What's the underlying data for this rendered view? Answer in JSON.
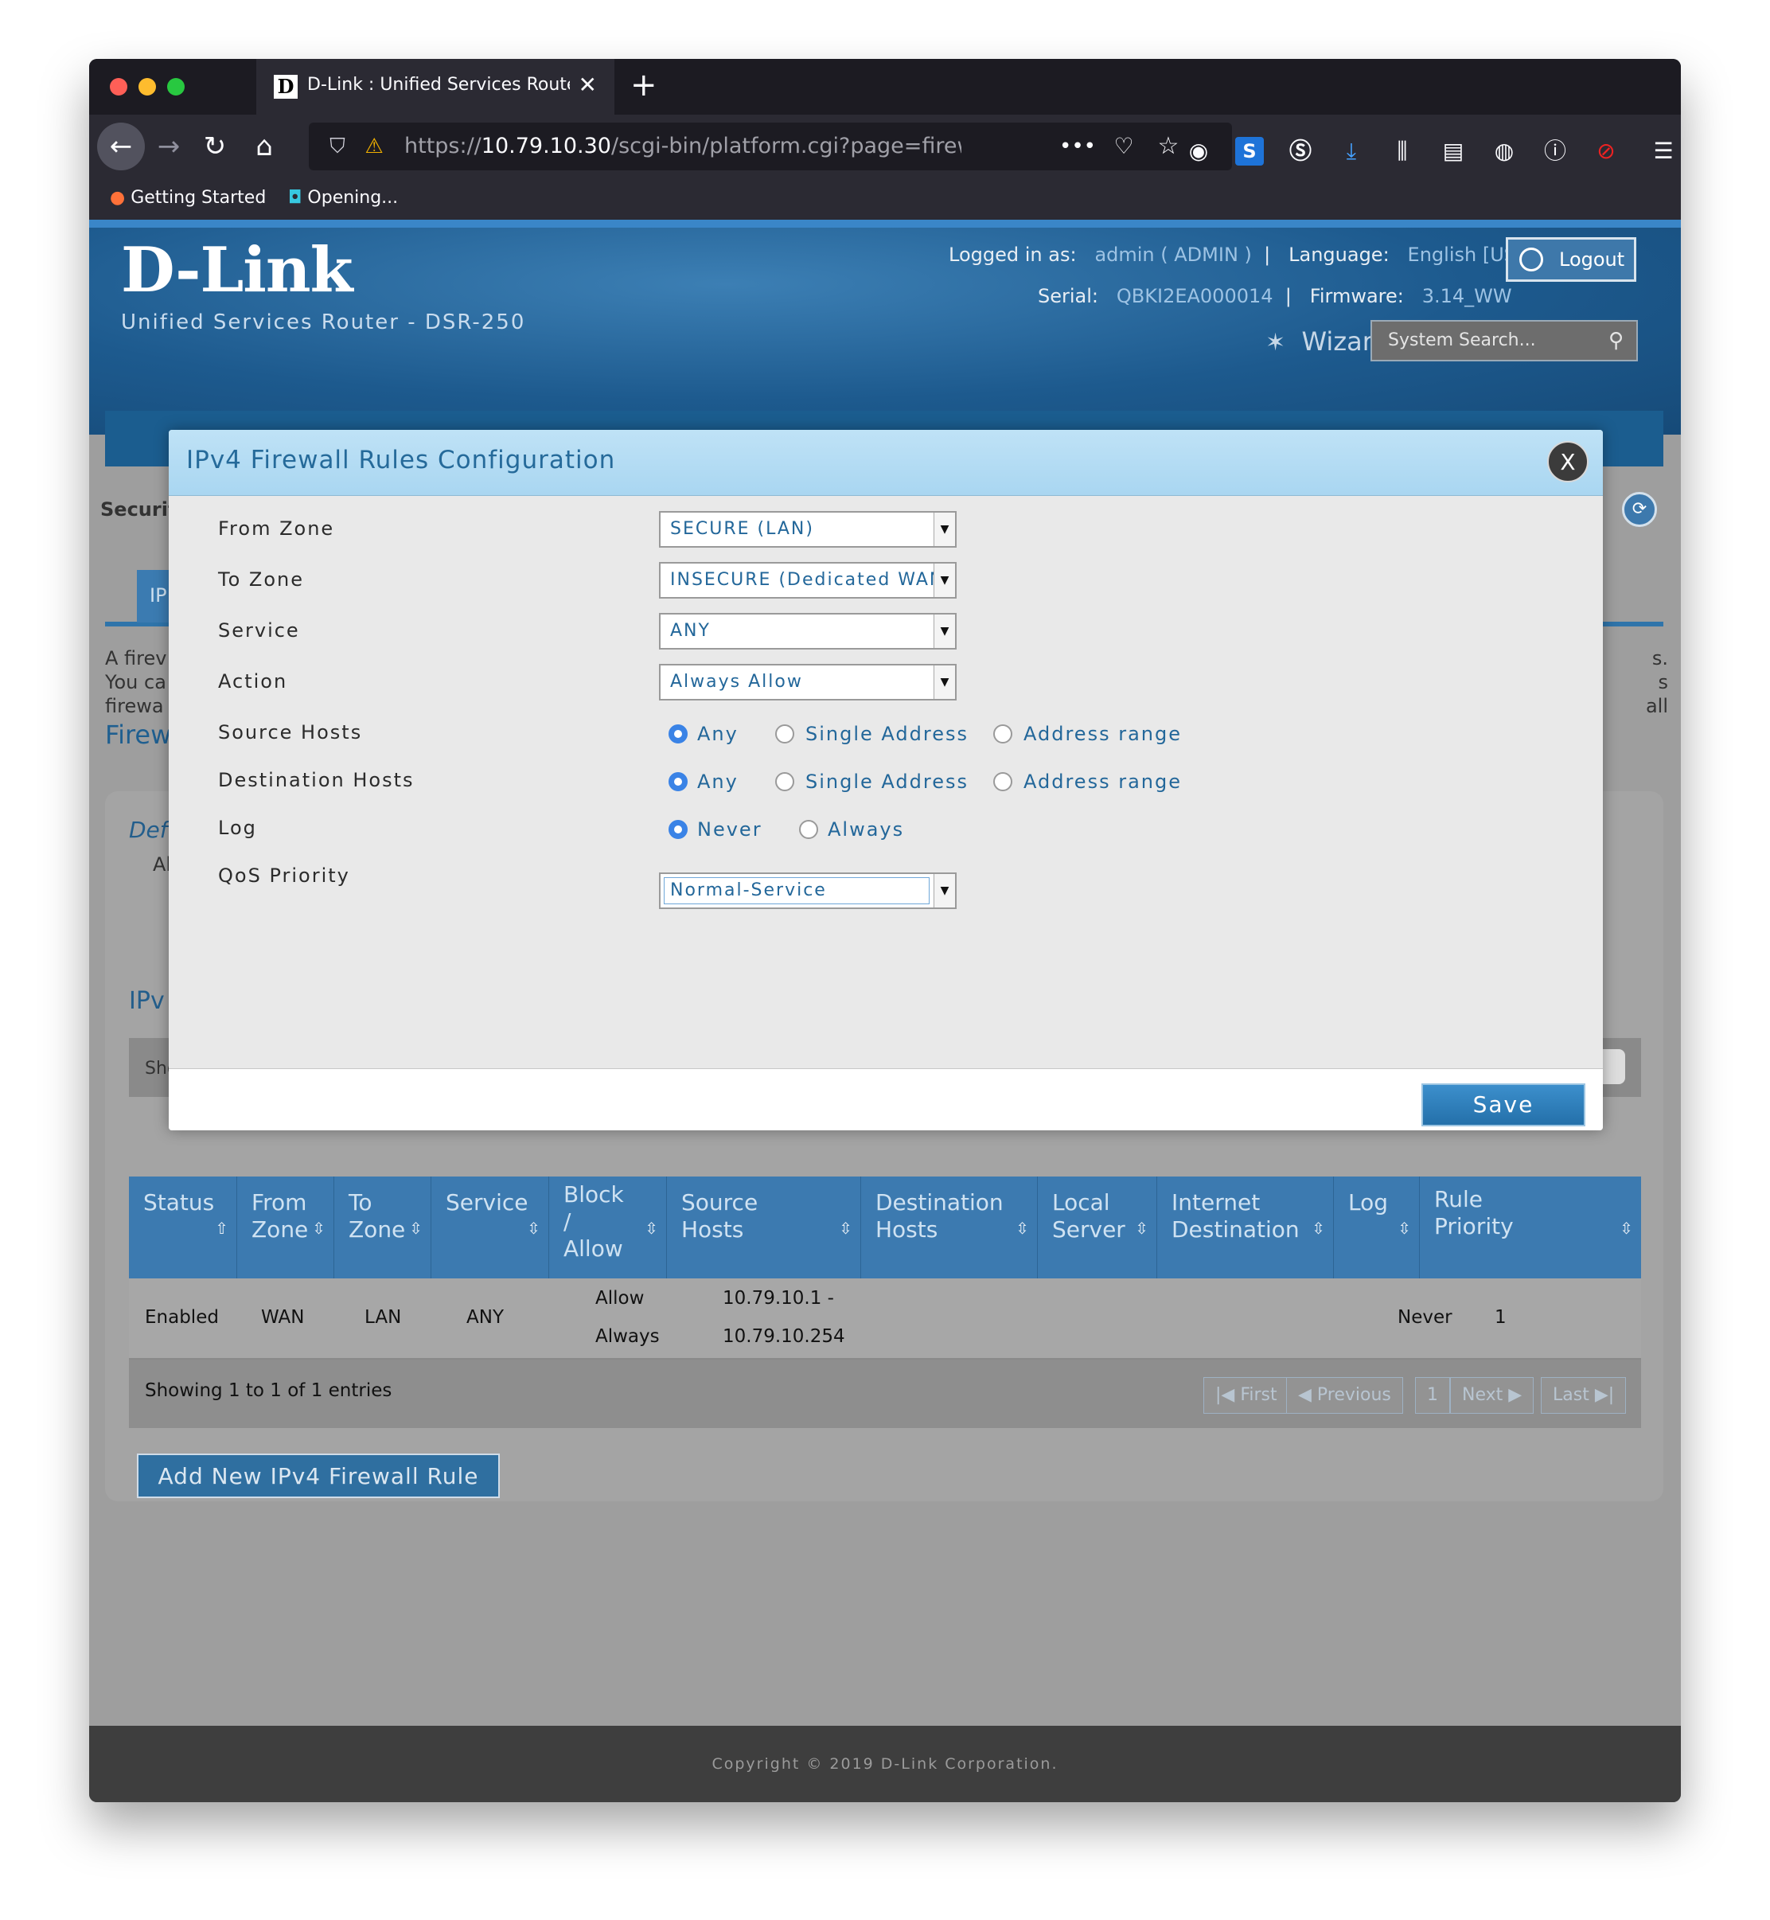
{
  "browser": {
    "tab_title": "D-Link : Unified Services Router",
    "favicon_letter": "D",
    "url_prefix": "https://",
    "url_host": "10.79.10.30",
    "url_path": "/scgi-bin/platform.cgi?page=firewall",
    "bookmarks": [
      {
        "label": "Getting Started",
        "icon": "firefox-icon"
      },
      {
        "label": "Opening...",
        "icon": "bookmark-icon"
      }
    ]
  },
  "header": {
    "logo": "D-Link",
    "subtitle": "Unified Services Router - DSR-250",
    "logged_in_label": "Logged in as:",
    "logged_in_value": "admin ( ADMIN )",
    "language_label": "Language:",
    "language_value": "English [US]",
    "serial_label": "Serial:",
    "serial_value": "QBKI2EA000014",
    "firmware_label": "Firmware:",
    "firmware_value": "3.14_WW",
    "logout": "Logout",
    "wizard": "Wizard",
    "search_placeholder": "System Search..."
  },
  "background": {
    "breadcrumb": "Securit",
    "tab": "IP",
    "desc_lines": [
      "A firev",
      "You ca",
      "firewa"
    ],
    "desc_right_lines": [
      "s.",
      "s all"
    ],
    "section": "Firew",
    "default_label": "Def",
    "default_sub": "Al",
    "ipv_label": "IPv",
    "show_label": "Sho"
  },
  "table": {
    "columns": [
      {
        "label": "Status",
        "sort": "up"
      },
      {
        "label": "From\nZone",
        "sort": "both"
      },
      {
        "label": "To\nZone",
        "sort": "both"
      },
      {
        "label": "Service",
        "sort": "both"
      },
      {
        "label": "Block\n/\nAllow",
        "sort": "both"
      },
      {
        "label": "Source\nHosts",
        "sort": "both"
      },
      {
        "label": "Destination\nHosts",
        "sort": "both"
      },
      {
        "label": "Local\nServer",
        "sort": "both"
      },
      {
        "label": "Internet\nDestination",
        "sort": "both"
      },
      {
        "label": "Log",
        "sort": "both"
      },
      {
        "label": "Rule\nPriority",
        "sort": "both"
      }
    ],
    "row": {
      "status": "Enabled",
      "from_zone": "WAN",
      "to_zone": "LAN",
      "service": "ANY",
      "action_line1": "Allow",
      "action_line2": "Always",
      "source_line1": "10.79.10.1 -",
      "source_line2": "10.79.10.254",
      "log": "Never",
      "priority": "1"
    },
    "showing": "Showing 1 to 1 of 1 entries",
    "pager": {
      "first": "First",
      "previous": "Previous",
      "page": "1",
      "next": "Next",
      "last": "Last"
    },
    "add_button": "Add New IPv4 Firewall Rule"
  },
  "footer": "Copyright © 2019 D-Link Corporation.",
  "modal": {
    "title": "IPv4 Firewall Rules Configuration",
    "close": "X",
    "fields": {
      "from_zone": {
        "label": "From Zone",
        "value": "SECURE (LAN)"
      },
      "to_zone": {
        "label": "To Zone",
        "value": "INSECURE (Dedicated WAN)"
      },
      "service": {
        "label": "Service",
        "value": "ANY"
      },
      "action": {
        "label": "Action",
        "value": "Always Allow"
      },
      "source_hosts": {
        "label": "Source Hosts",
        "options": [
          "Any",
          "Single Address",
          "Address range"
        ],
        "selected": "Any"
      },
      "destination_hosts": {
        "label": "Destination Hosts",
        "options": [
          "Any",
          "Single Address",
          "Address range"
        ],
        "selected": "Any"
      },
      "log": {
        "label": "Log",
        "options": [
          "Never",
          "Always"
        ],
        "selected": "Never"
      },
      "qos_priority": {
        "label": "QoS Priority",
        "value": "Normal-Service"
      }
    },
    "save": "Save"
  },
  "colors": {
    "accent": "#3c7ab0",
    "modal_title": "#256a9a",
    "radio_selected": "#3a83e6"
  }
}
